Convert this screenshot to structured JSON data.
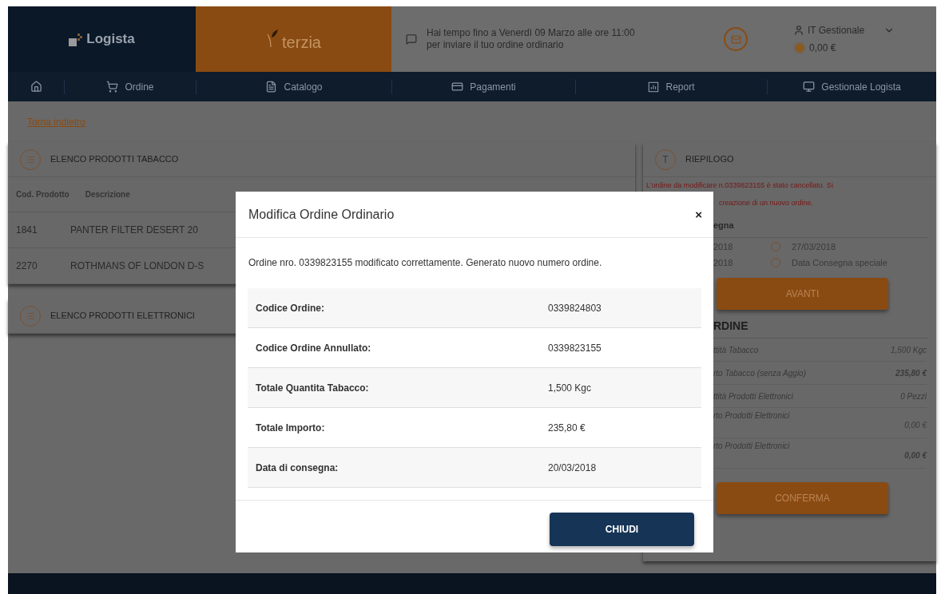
{
  "header": {
    "logo": "Logista",
    "partner_logo": "terzia",
    "notice_lines": [
      "Hai tempo fino a Venerdì 09 Marzo alle ore 11:00",
      "per inviare il tuo ordine ordinario"
    ],
    "user": "IT Gestionale",
    "balance": "0,00 €"
  },
  "nav": [
    "Ordine",
    "Catalogo",
    "Pagamenti",
    "Report",
    "Gestionale Logista"
  ],
  "back_link": "Torna indietro",
  "product_lists": [
    {
      "title": "ELENCO PRODOTTI TABACCO",
      "columns": [
        "Cod. Prodotto",
        "Descrizione"
      ],
      "rows": [
        {
          "code": "1841",
          "description": "PANTER FILTER DESERT 20"
        },
        {
          "code": "2270",
          "description": "ROTHMANS OF LONDON D-S"
        }
      ]
    },
    {
      "title": "ELENCO PRODOTTI ELETTRONICI"
    }
  ],
  "summary": {
    "badge": "T",
    "title": "RIEPILOGO",
    "alert_lines": [
      "L'ordine da modificare n.0339823155 è stato cancellato. Si",
      "creazione di un nuovo ordine."
    ],
    "delivery_heading": "egna",
    "delivery_options": [
      {
        "date": "2018",
        "alternative": "27/03/2018",
        "checked": false
      },
      {
        "date": "2018",
        "alternative": "Data Consegna speciale",
        "checked": false
      }
    ],
    "next_button": "AVANTI",
    "order_heading": "RDINE",
    "totals": [
      {
        "label": "ttità Tabacco",
        "value": "1,500 Kgc",
        "bold": false
      },
      {
        "label": "rto Tabacco (senza Aggio)",
        "value": "235,80 €",
        "bold": true
      },
      {
        "label": "ttità Prodotti Elettronici",
        "value": "0 Pezzi",
        "bold": false
      },
      {
        "label": "rto Prodotti Elettronici",
        "value": "0,00 €",
        "bold": false
      },
      {
        "label": "rto Prodotti Elettronici",
        "value": "0,00 €",
        "bold": true
      }
    ],
    "confirm_button": "CONFERMA"
  },
  "dialog": {
    "title": "Modifica Ordine Ordinario",
    "close": "×",
    "message": "Ordine nro. 0339823155 modificato correttamente. Generato nuovo numero ordine.",
    "rows": [
      {
        "label": "Codice Ordine:",
        "value": "0339824803"
      },
      {
        "label": "Codice Ordine Annullato:",
        "value": "0339823155"
      },
      {
        "label": "Totale Quantita Tabacco:",
        "value": "1,500 Kgc"
      },
      {
        "label": "Totale Importo:",
        "value": "235,80 €"
      },
      {
        "label": "Data di consegna:",
        "value": "20/03/2018"
      }
    ],
    "button": "CHIUDI"
  }
}
